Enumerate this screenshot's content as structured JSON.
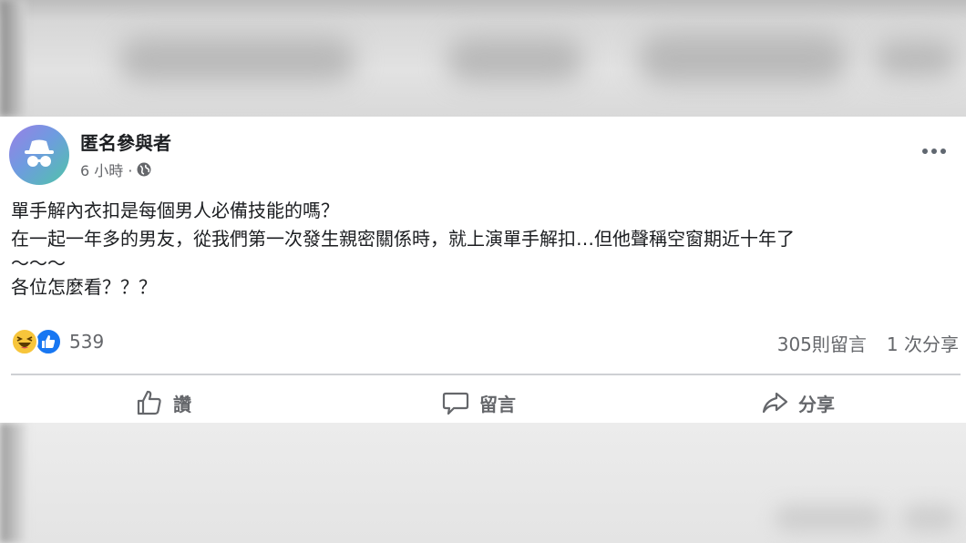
{
  "post": {
    "author": "匿名參與者",
    "time": "6 小時 ·",
    "privacy_icon": "globe-icon",
    "lines": [
      "單手解內衣扣是每個男人必備技能的嗎？",
      "在一起一年多的男友，從我們第一次發生親密關係時，就上演單手解扣…但他聲稱空窗期近十年了",
      "～～～",
      "各位怎麼看？？？"
    ],
    "reaction_count": "539",
    "comments": "305則留言",
    "shares": "1 次分享"
  },
  "actions": {
    "like": "讚",
    "comment": "留言",
    "share": "分享"
  },
  "colors": {
    "like_blue": "#1877f2",
    "haha_yellow": "#f7c53b",
    "secondary_text": "#65676b"
  }
}
